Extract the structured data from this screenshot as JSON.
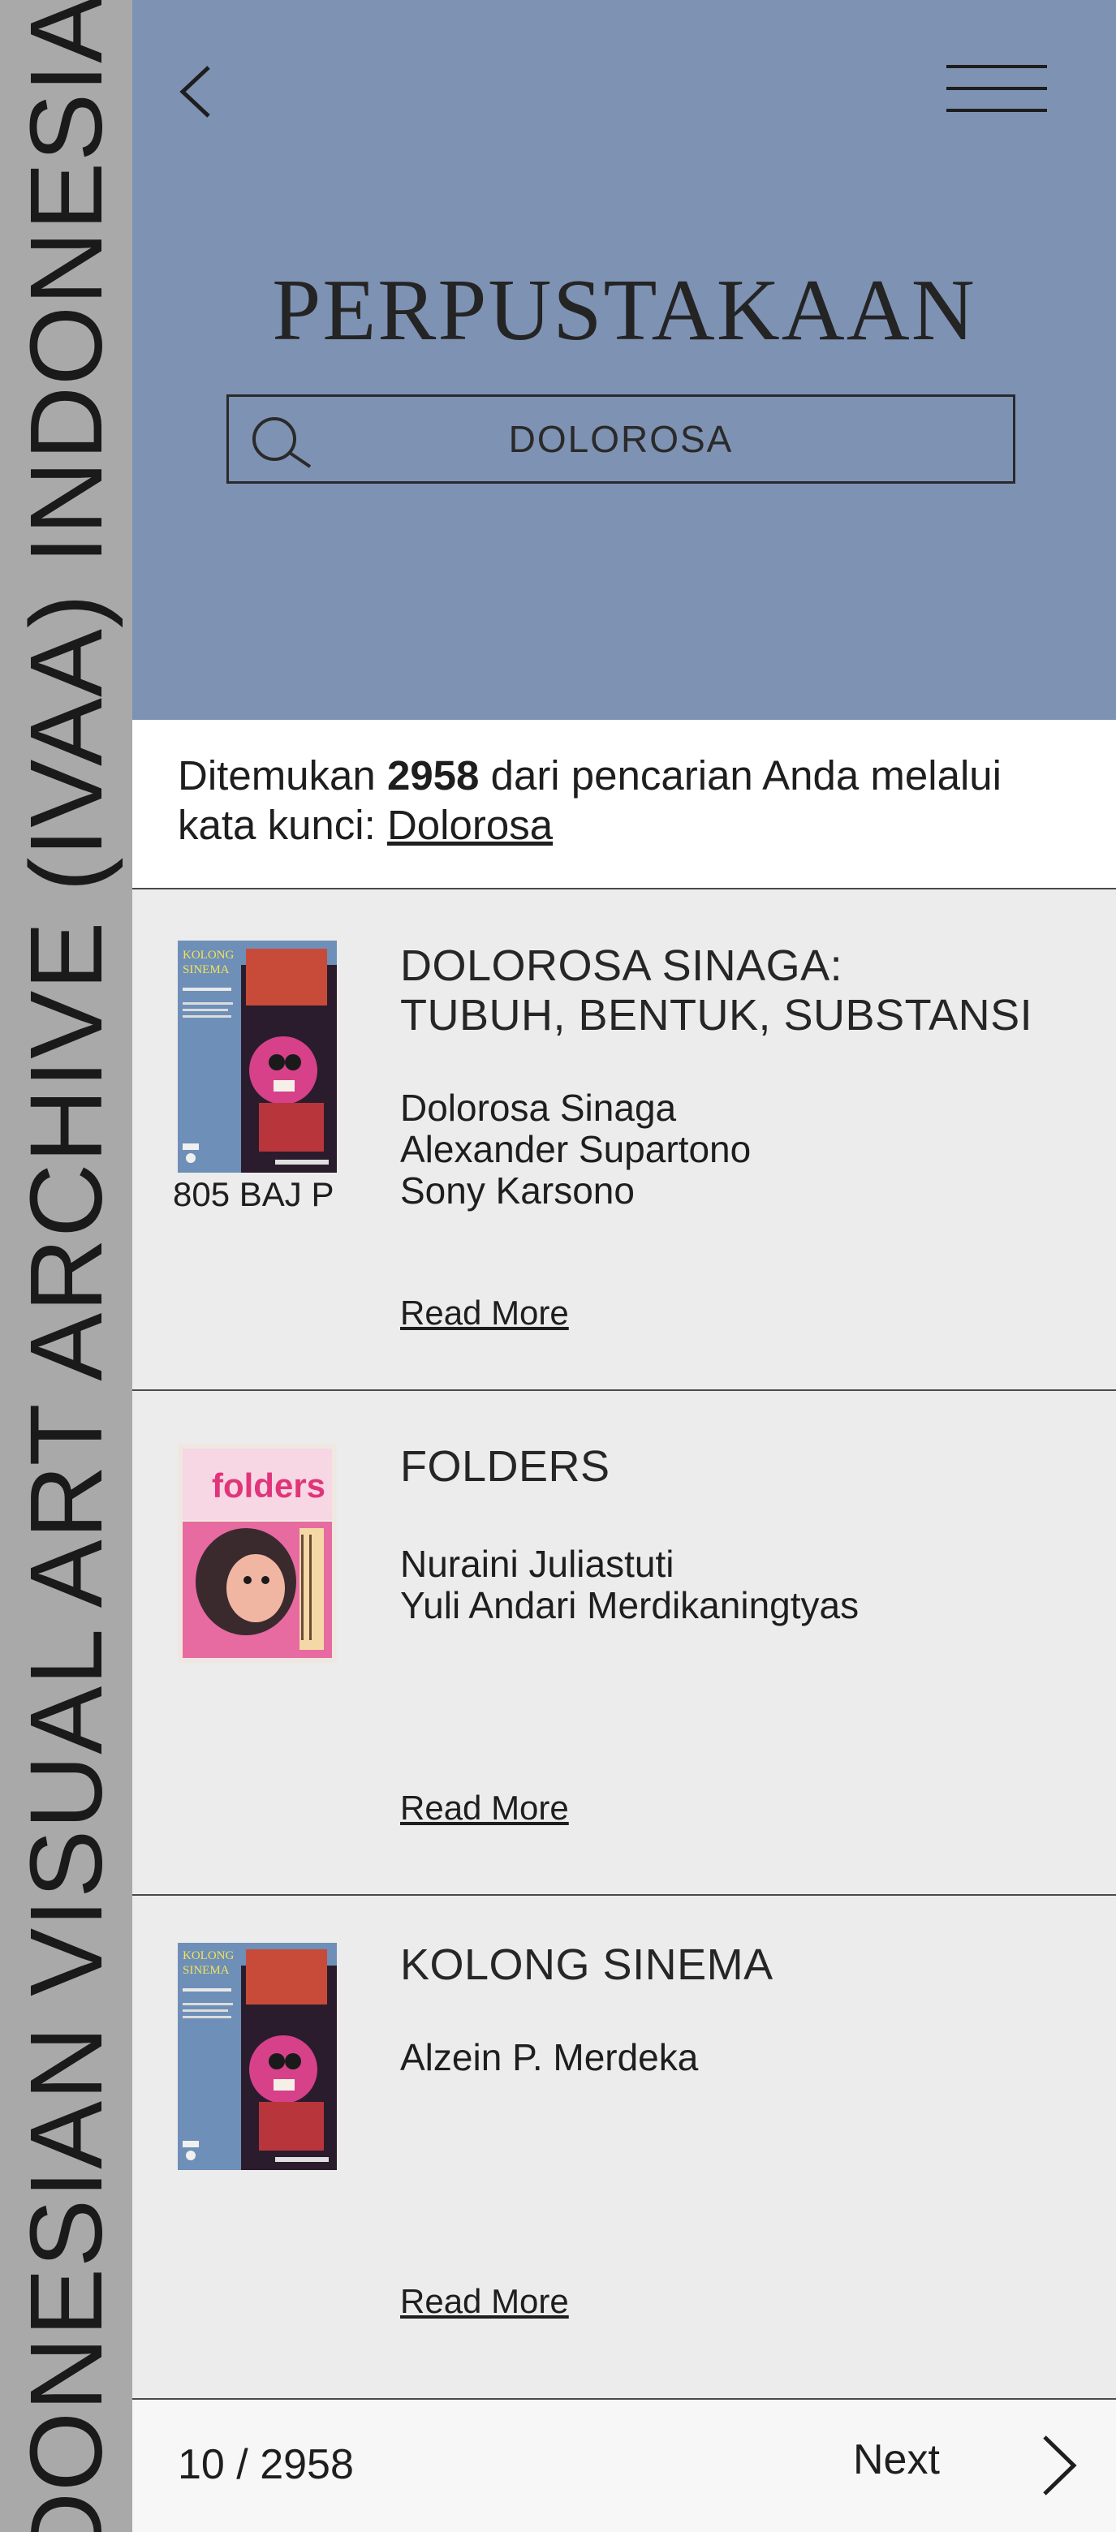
{
  "side_banner": {
    "text": "INDONESIAN VISUAL ART ARCHIVE (IVAA) INDONESIAN VISUAL ART ARCHIVE (IVAA)"
  },
  "header": {
    "back_icon": "chevron-left-icon",
    "menu_icon": "hamburger-menu-icon",
    "title": "PERPUSTAKAAN",
    "search": {
      "icon": "search-icon",
      "value": "DOLOROSA"
    },
    "background": "#7e92b3"
  },
  "summary": {
    "prefix": "Ditemukan ",
    "count": "2958",
    "middle": " dari pencarian Anda melalui kata kunci: ",
    "keyword": "Dolorosa"
  },
  "results": [
    {
      "title_line1": "DOLOROSA SINAGA:",
      "title_line2": "TUBUH, BENTUK, SUBSTANSI",
      "call_number": "805 BAJ P",
      "authors": [
        "Dolorosa Sinaga",
        "Alexander Supartono",
        "Sony Karsono"
      ],
      "read_more": "Read More",
      "cover_text": "KOLONG SINEMA"
    },
    {
      "title_line1": "FOLDERS",
      "title_line2": "",
      "call_number": "",
      "authors": [
        "Nuraini Juliastuti",
        "Yuli Andari Merdikaningtyas"
      ],
      "read_more": "Read More",
      "cover_text": "folders"
    },
    {
      "title_line1": "KOLONG SINEMA",
      "title_line2": "",
      "call_number": "",
      "authors": [
        "Alzein P. Merdeka"
      ],
      "read_more": "Read More",
      "cover_text": "KOLONG SINEMA"
    }
  ],
  "pagination": {
    "current": "10",
    "separator": " / ",
    "total": "2958",
    "next_label": "Next",
    "next_icon": "chevron-right-icon"
  },
  "colors": {
    "side_band": "#a9a9a9",
    "header": "#7e92b3",
    "result_bg": "#ececec",
    "folders_pink": "#e0357b"
  }
}
